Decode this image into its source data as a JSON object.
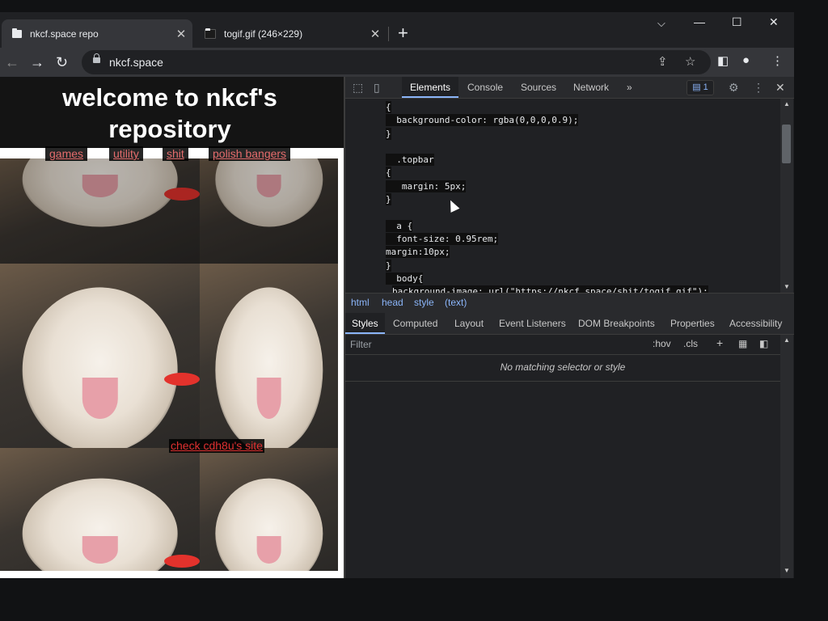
{
  "browser": {
    "tabs": [
      {
        "title": "nkcf.space repo",
        "active": true
      },
      {
        "title": "togif.gif (246×229)",
        "active": false
      }
    ],
    "new_tab_label": "+",
    "url": "nkcf.space",
    "icons": {
      "back": "arrow-left-icon",
      "forward": "arrow-right-icon",
      "reload": "reload-icon",
      "lock": "lock-icon",
      "share": "share-icon",
      "star": "star-icon",
      "sidepanel": "side-panel-icon",
      "profile": "profile-icon",
      "menu": "kebab-menu-icon"
    },
    "window_controls": {
      "dropdown": "⌵",
      "minimize": "—",
      "maximize": "☐",
      "close": "✕"
    }
  },
  "page": {
    "title": "welcome to nkcf's repository",
    "nav": [
      "games",
      "utility",
      "shit",
      "polish bangers"
    ],
    "link_bottom": "check cdh8u's site"
  },
  "devtools": {
    "tabs": [
      "Elements",
      "Console",
      "Sources",
      "Network"
    ],
    "more": "»",
    "issues_count": "1",
    "code_lines": [
      "{",
      "  background-color: rgba(0,0,0,0.9);",
      "}",
      "  .topbar",
      "{",
      "   margin: 5px;",
      "}",
      "  a {",
      "  font-size: 0.95rem;",
      "margin:10px;",
      "}",
      "  body{",
      "background-image: url(\"https://nkcf.space/shit/togif.gif\");"
    ],
    "breadcrumbs": [
      "html",
      "head",
      "style",
      "(text)"
    ],
    "subtabs": [
      "Styles",
      "Computed",
      "Layout",
      "Event Listeners",
      "DOM Breakpoints",
      "Properties",
      "Accessibility"
    ],
    "filter_placeholder": "Filter",
    "filter_buttons": [
      ":hov",
      ".cls",
      "+"
    ],
    "no_match": "No matching selector or style"
  },
  "colors": {
    "link": "#e56c6c",
    "accent": "#8ab4f8",
    "devtools_bg": "#202124"
  }
}
